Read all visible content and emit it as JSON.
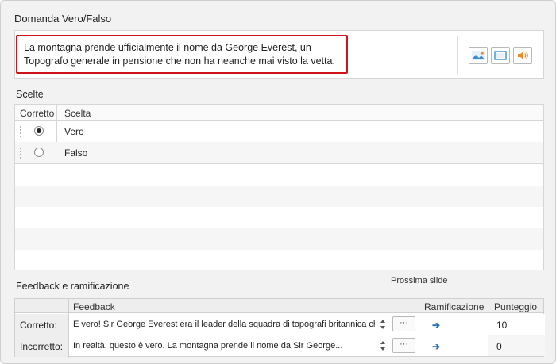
{
  "title": "Domanda Vero/Falso",
  "question": {
    "text": "La montagna prende ufficialmente il nome da George Everest, un Topografo generale in pensione che non ha neanche mai visto la vetta."
  },
  "media_buttons": [
    {
      "icon": "image-icon"
    },
    {
      "icon": "video-icon"
    },
    {
      "icon": "audio-icon"
    }
  ],
  "choices": {
    "label": "Scelte",
    "headers": {
      "correct": "Corretto",
      "choice": "Scelta"
    },
    "rows": [
      {
        "label": "Vero",
        "checked": true
      },
      {
        "label": "Falso",
        "checked": false
      }
    ]
  },
  "feedback": {
    "label": "Feedback e ramificazione",
    "next_slide": "Prossima slide",
    "headers": {
      "feedback": "Feedback",
      "branching": "Ramificazione",
      "score": "Punteggio"
    },
    "rows": [
      {
        "label": "Corretto:",
        "text": "È vero! Sir George Everest era il leader della squadra di topografi britannica che",
        "more": "···",
        "score": "10"
      },
      {
        "label": "Incorretto:",
        "text": "In realtà, questo è vero. La montagna prende il nome da Sir George...",
        "more": "···",
        "score": "0"
      }
    ]
  },
  "colors": {
    "accent_border": "#d0121b",
    "arrow": "#2b6fb3"
  }
}
